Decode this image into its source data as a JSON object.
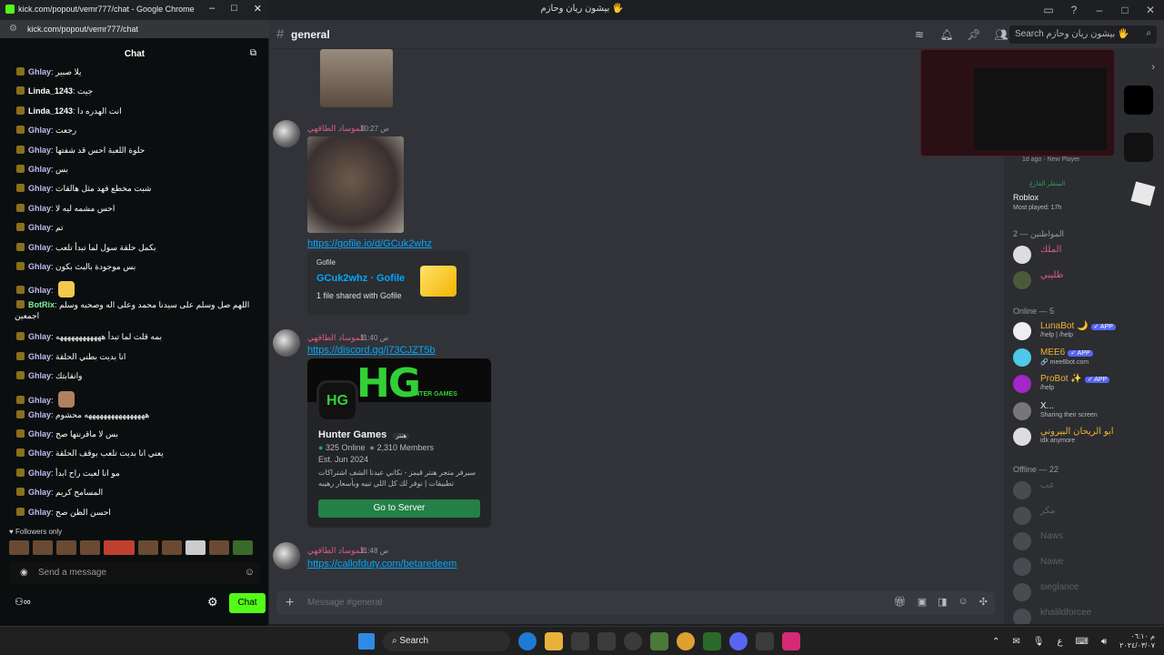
{
  "discord": {
    "window_title": "بيشون ريان وحازم 🖐",
    "channel": "general",
    "search_placeholder": "Search بيشون ريان وحازم 🖐",
    "messages": [
      {
        "author": "الموساد الطاقهي",
        "time": "ص 10:27",
        "link": "https://gofile.io/d/GCuk2whz",
        "embed": {
          "provider": "Gofile",
          "title": "GCuk2whz · Gofile",
          "desc": "1 file shared with Gofile"
        }
      },
      {
        "author": "الموساد الطاقهي",
        "time": "ص 11:40",
        "link": "https://discord.gg/j73CJZT5b",
        "invite": {
          "name": "Hunter Games",
          "tag": "هنتر",
          "online": "325 Online",
          "members": "2,310 Members",
          "est": "Est. Jun 2024",
          "desc": "سيرفر متجر هنتر قيمز - نكاني عيدنا الشف اشتراكات تطبيقات | نوفر لك كل اللي تبيه وبأسعار رهيبه",
          "button": "Go to Server",
          "logo": "HG",
          "logo_sub": "HUNTER GAMES"
        }
      },
      {
        "author": "الموساد الطاقهي",
        "time": "ص 11:48",
        "link": "https://callofduty.com/betaredeem"
      }
    ],
    "composer_placeholder": "Message #general",
    "members": {
      "activity": {
        "ago": "1d ago",
        "tag": "New Player",
        "user": "المتفلر الفارغ",
        "game": "Roblox",
        "played": "Most played: 17h"
      },
      "section_citizens": "المواطنين — 2",
      "citizens": [
        "الملك",
        "ظليبي"
      ],
      "section_online": "Online — 5",
      "online": [
        {
          "name": "LunaBot 🌙",
          "badge": "✓ APP",
          "status": "/help | /help"
        },
        {
          "name": "MEE6",
          "badge": "✓ APP",
          "status": "🔗 mee6bot.com"
        },
        {
          "name": "ProBot ✨",
          "badge": "✓ APP",
          "status": "/help"
        },
        {
          "name": "X...",
          "badge": "",
          "status": "Sharing their screen"
        },
        {
          "name": "ابو الريحان البيروني",
          "badge": "",
          "status": "idk anymore"
        }
      ],
      "section_offline": "Offline — 22",
      "offline": [
        "عب",
        "مكر",
        "Naws",
        "Nawe",
        "sieglance",
        "khalildforcee"
      ]
    }
  },
  "kick": {
    "chrome_title": "kick.com/popout/vemr777/chat - Google Chrome",
    "url": "kick.com/popout/vemr777/chat",
    "chat_title": "Chat",
    "lines": [
      {
        "user": "Ghlay",
        "text": "يلا صبير"
      },
      {
        "user": "Linda_1243",
        "text": "جيت"
      },
      {
        "user": "Linda_1243",
        "text": "انت الهدره دا"
      },
      {
        "user": "Ghlay",
        "text": "رجعت"
      },
      {
        "user": "Ghlay",
        "text": "حلوة اللعبة احس قد شفتها"
      },
      {
        "user": "Ghlay",
        "text": "بس"
      },
      {
        "user": "Ghlay",
        "text": "شبت مخطع فهد مثل هالقات"
      },
      {
        "user": "Ghlay",
        "text": "احس مشمه ليه لا"
      },
      {
        "user": "Ghlay",
        "text": "تم"
      },
      {
        "user": "Ghlay",
        "text": "بكمل حلقة سول لما تبدأ تلعب"
      },
      {
        "user": "Ghlay",
        "text": "بس موجودة بالبث بكون"
      },
      {
        "user": "Ghlay",
        "text": ""
      },
      {
        "user": "BotRix",
        "text": "اللهم صل وسلم على سيدنا محمد وعلى اله وصحبه وسلم"
      },
      {
        "user": "Ghlay",
        "text": "بمه قلت لما تبدأ ههههههههههههه"
      },
      {
        "user": "Ghlay",
        "text": "انا بديت بطني الحلقة"
      },
      {
        "user": "Ghlay",
        "text": "وانقابتك"
      },
      {
        "user": "Ghlay",
        "text": ""
      },
      {
        "user": "Ghlay",
        "text": "ههههههههههههههههه محشوم"
      },
      {
        "user": "Ghlay",
        "text": "بس لا ماقرنتها صح"
      },
      {
        "user": "Ghlay",
        "text": "يعني انا بديت تلعب بوقف الحلقة"
      },
      {
        "user": "Ghlay",
        "text": "مو انا لعبت راح ابدأ"
      },
      {
        "user": "Ghlay",
        "text": "المسامح كريم"
      },
      {
        "user": "Ghlay",
        "text": "احسن الظن صح"
      }
    ],
    "botrix_extra": "اجمعين",
    "followers_only": "Followers only",
    "send_placeholder": "Send a message",
    "chat_button": "Chat"
  },
  "taskbar": {
    "search": "Search",
    "time": "م ٠٦:١٠",
    "date": "٢٠٢٤/٠٣/٠٧",
    "lang": "ع"
  }
}
